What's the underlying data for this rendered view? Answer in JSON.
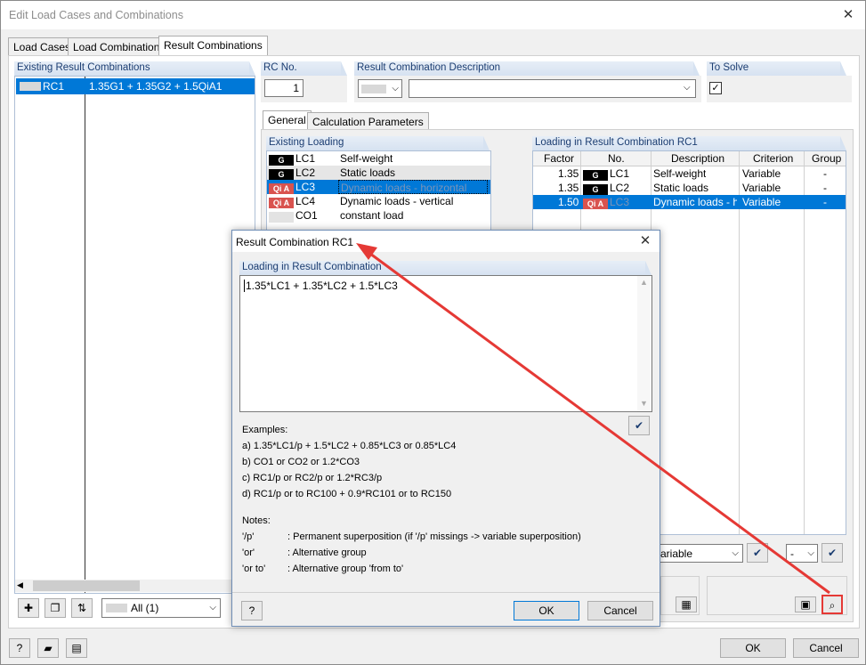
{
  "window": {
    "title": "Edit Load Cases and Combinations",
    "close": "✕"
  },
  "tabs": [
    {
      "label": "Load Cases",
      "active": false
    },
    {
      "label": "Load Combinations",
      "active": false
    },
    {
      "label": "Result Combinations",
      "active": true
    }
  ],
  "existing_rc": {
    "header": "Existing Result Combinations",
    "rows": [
      {
        "no": "RC1",
        "formula": "1.35G1 + 1.35G2 + 1.5QiA1",
        "selected": true
      }
    ],
    "filter": "All (1)"
  },
  "rc_no": {
    "label": "RC No.",
    "value": "1"
  },
  "rc_desc": {
    "label": "Result Combination Description",
    "value": ""
  },
  "to_solve": {
    "label": "To Solve",
    "checked": "✓"
  },
  "sub_tabs": [
    {
      "label": "General"
    },
    {
      "label": "Calculation Parameters"
    }
  ],
  "existing_loading": {
    "header": "Existing Loading",
    "rows": [
      {
        "badge": "G",
        "kind": "g",
        "no": "LC1",
        "desc": "Self-weight"
      },
      {
        "badge": "G",
        "kind": "g",
        "no": "LC2",
        "desc": "Static loads"
      },
      {
        "badge": "Qi A",
        "kind": "q",
        "no": "LC3",
        "desc": "Dynamic loads - horizontal"
      },
      {
        "badge": "Qi A",
        "kind": "q",
        "no": "LC4",
        "desc": "Dynamic loads - vertical"
      },
      {
        "badge": "",
        "kind": "e",
        "no": "CO1",
        "desc": "constant load"
      }
    ]
  },
  "loading_rc": {
    "header": "Loading in Result Combination RC1",
    "columns": [
      "Factor",
      "No.",
      "Description",
      "Criterion",
      "Group"
    ],
    "rows": [
      {
        "factor": "1.35",
        "badge": "G",
        "kind": "g",
        "no": "LC1",
        "desc": "Self-weight",
        "criterion": "Variable",
        "group": "-"
      },
      {
        "factor": "1.35",
        "badge": "G",
        "kind": "g",
        "no": "LC2",
        "desc": "Static loads",
        "criterion": "Variable",
        "group": "-"
      },
      {
        "factor": "1.50",
        "badge": "Qi A",
        "kind": "q",
        "no": "LC3",
        "desc": "Dynamic loads - ho",
        "criterion": "Variable",
        "group": "-"
      }
    ],
    "criterion_select": "ariable",
    "group_select": "-"
  },
  "dialog": {
    "title": "Result Combination RC1",
    "close": "✕",
    "section": "Loading in Result Combination",
    "formula": "1.35*LC1 + 1.35*LC2 + 1.5*LC3",
    "examples_title": "Examples:",
    "examples": [
      "a)  1.35*LC1/p + 1.5*LC2 + 0.85*LC3 or 0.85*LC4",
      "b)  CO1 or CO2 or 1.2*CO3",
      "c)  RC1/p or RC2/p or 1.2*RC3/p",
      "d)  RC1/p or to RC100 + 0.9*RC101 or to RC150"
    ],
    "notes_title": "Notes:",
    "notes": [
      {
        "key": "'/p'",
        "text": ": Permanent superposition (if '/p' missings -> variable superposition)"
      },
      {
        "key": "'or'",
        "text": ": Alternative group"
      },
      {
        "key": "'or to'",
        "text": ": Alternative group 'from to'"
      }
    ],
    "ok": "OK",
    "cancel": "Cancel"
  },
  "footer": {
    "ok": "OK",
    "cancel": "Cancel"
  },
  "colors": {
    "accent": "#0078d7",
    "highlight": "#e53935",
    "panel_header": "#1b3d71"
  }
}
